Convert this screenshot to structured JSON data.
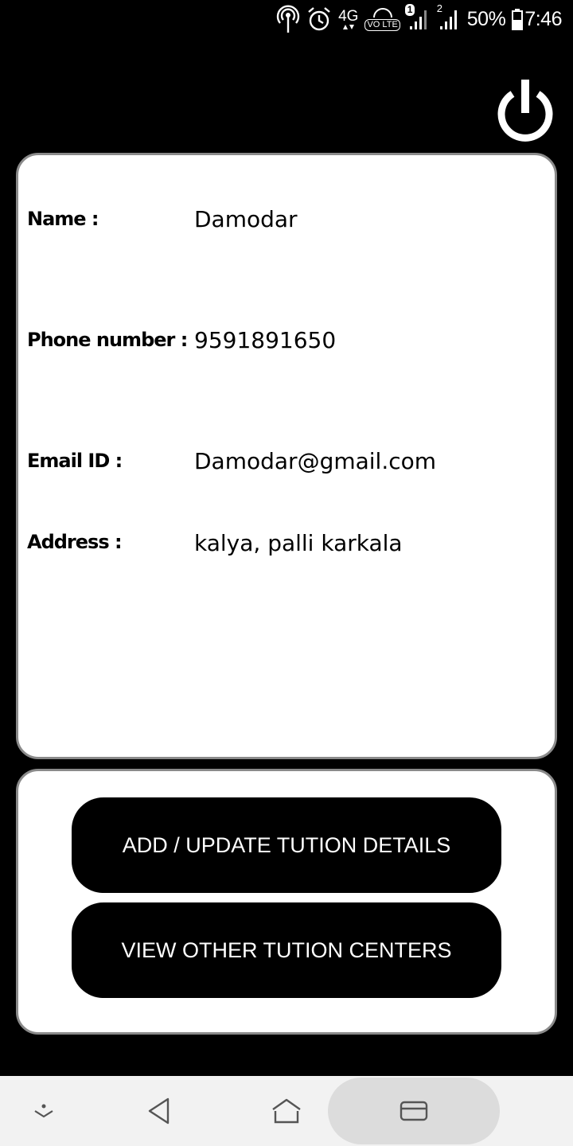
{
  "status_bar": {
    "network": "4G",
    "volte": "VO LTE",
    "sim1": "1",
    "sim2": "2",
    "battery": "50%",
    "time": "7:46"
  },
  "profile": {
    "name_label": "Name :",
    "name_value": "Damodar",
    "phone_label": "Phone number :",
    "phone_value": "9591891650",
    "email_label": "Email ID :",
    "email_value": "Damodar@gmail.com",
    "address_label": "Address :",
    "address_value": "kalya, palli karkala"
  },
  "actions": {
    "add_update": "ADD / UPDATE TUTION DETAILS",
    "view_other": "VIEW OTHER TUTION CENTERS"
  },
  "icons": {
    "power": "power-icon",
    "hotspot": "hotspot-icon",
    "alarm": "alarm-icon",
    "battery": "battery-icon",
    "nav_down": "chevron-down-icon",
    "nav_back": "back-icon",
    "nav_home": "home-icon",
    "nav_recents": "recents-icon"
  },
  "colors": {
    "background": "#000000",
    "card": "#ffffff",
    "card_border": "#8a8a8a",
    "button": "#000000",
    "button_text": "#ffffff",
    "nav_bar": "#f2f2f2"
  }
}
